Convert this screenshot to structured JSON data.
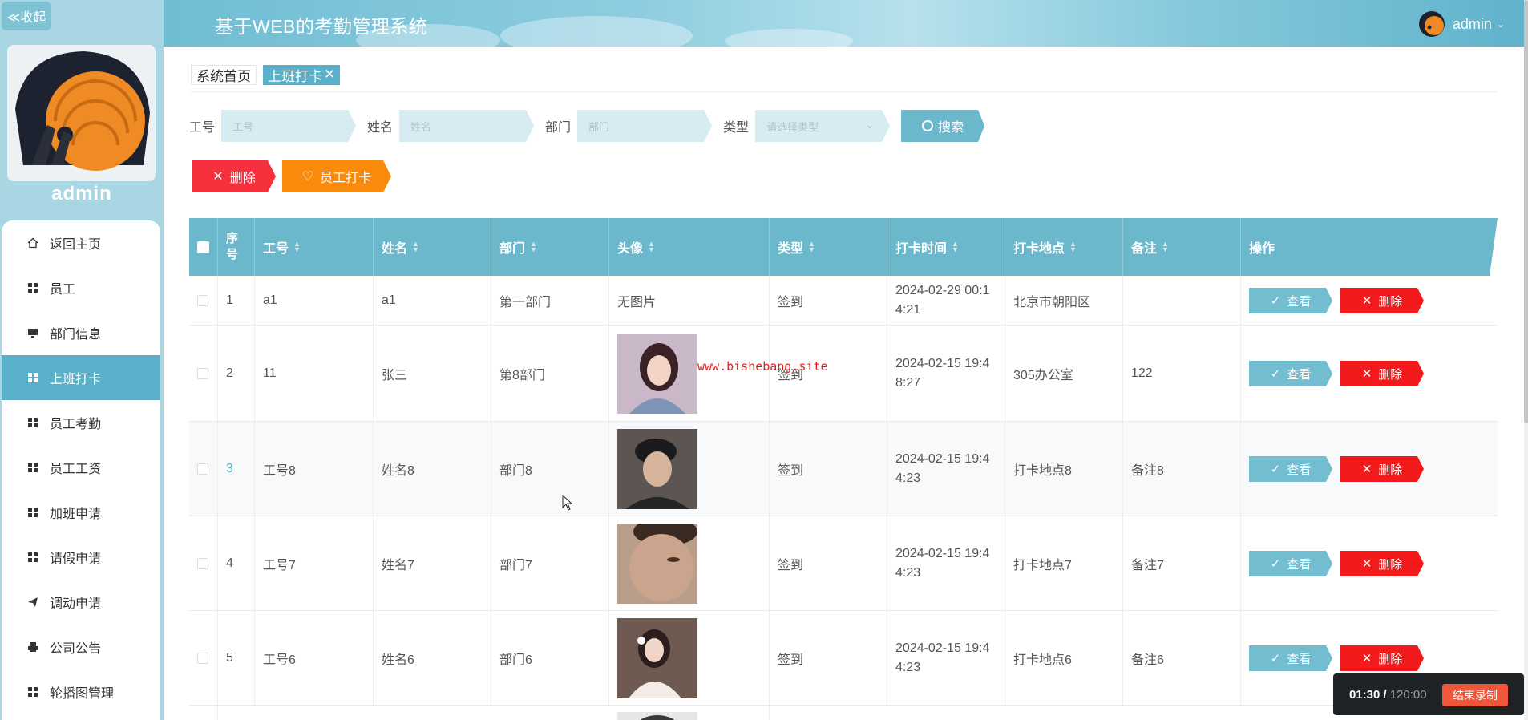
{
  "sidebar": {
    "collapse_label": "≪收起",
    "username": "admin",
    "items": [
      {
        "label": "返回主页",
        "icon": "home-icon"
      },
      {
        "label": "员工",
        "icon": "grid-icon"
      },
      {
        "label": "部门信息",
        "icon": "monitor-icon"
      },
      {
        "label": "上班打卡",
        "icon": "grid-icon",
        "active": true
      },
      {
        "label": "员工考勤",
        "icon": "grid-icon"
      },
      {
        "label": "员工工资",
        "icon": "grid-icon"
      },
      {
        "label": "加班申请",
        "icon": "grid-icon"
      },
      {
        "label": "请假申请",
        "icon": "grid-icon"
      },
      {
        "label": "调动申请",
        "icon": "send-icon"
      },
      {
        "label": "公司公告",
        "icon": "print-icon"
      },
      {
        "label": "轮播图管理",
        "icon": "grid-icon"
      }
    ]
  },
  "header": {
    "title": "基于WEB的考勤管理系统",
    "user": "admin"
  },
  "breadcrumb": {
    "home": "系统首页",
    "current": "上班打卡",
    "close": "✕"
  },
  "search": {
    "fields": [
      {
        "label": "工号",
        "placeholder": "工号"
      },
      {
        "label": "姓名",
        "placeholder": "姓名"
      },
      {
        "label": "部门",
        "placeholder": "部门"
      },
      {
        "label": "类型",
        "placeholder": "请选择类型"
      }
    ],
    "button": "搜索"
  },
  "actions": {
    "delete": "删除",
    "punch": "员工打卡"
  },
  "table": {
    "headers": [
      "序号",
      "工号",
      "姓名",
      "部门",
      "头像",
      "类型",
      "打卡时间",
      "打卡地点",
      "备注",
      "操作"
    ],
    "view_label": "查看",
    "delete_label": "删除",
    "rows": [
      {
        "seq": "1",
        "id": "a1",
        "name": "a1",
        "dept": "第一部门",
        "avatar": "无图片",
        "type": "签到",
        "time": "2024-02-29 00:14:21",
        "place": "北京市朝阳区",
        "note": ""
      },
      {
        "seq": "2",
        "id": "11",
        "name": "张三",
        "dept": "第8部门",
        "avatar": "",
        "type": "签到",
        "time": "2024-02-15 19:48:27",
        "place": "305办公室",
        "note": "122"
      },
      {
        "seq": "3",
        "id": "工号8",
        "name": "姓名8",
        "dept": "部门8",
        "avatar": "",
        "type": "签到",
        "time": "2024-02-15 19:44:23",
        "place": "打卡地点8",
        "note": "备注8"
      },
      {
        "seq": "4",
        "id": "工号7",
        "name": "姓名7",
        "dept": "部门7",
        "avatar": "",
        "type": "签到",
        "time": "2024-02-15 19:44:23",
        "place": "打卡地点7",
        "note": "备注7"
      },
      {
        "seq": "5",
        "id": "工号6",
        "name": "姓名6",
        "dept": "部门6",
        "avatar": "",
        "type": "签到",
        "time": "2024-02-15 19:44:23",
        "place": "打卡地点6",
        "note": "备注6"
      }
    ]
  },
  "watermark": "www.bishebang.site",
  "recorder": {
    "elapsed": "01:30 /",
    "total": "120:00",
    "stop": "结束录制"
  }
}
